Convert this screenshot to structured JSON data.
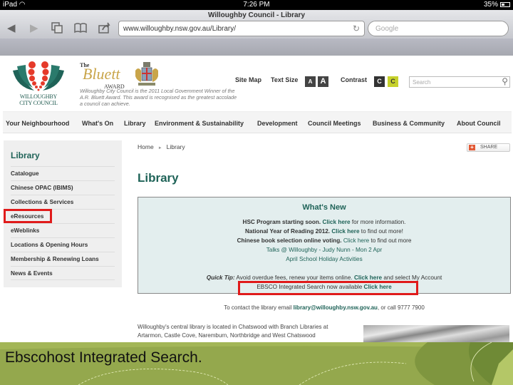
{
  "status_bar": {
    "device": "iPad",
    "time": "7:26 PM",
    "battery": "35%"
  },
  "browser": {
    "page_title": "Willoughby Council - Library",
    "url": "www.willoughby.nsw.gov.au/Library/",
    "search_placeholder": "Google"
  },
  "header": {
    "logo_line1": "WILLOUGHBY",
    "logo_line2": "CITY COUNCIL",
    "award_the": "The",
    "award_name": "Bluett",
    "award_word": "AWARD",
    "award_text": "Willoughby City Council is the 2011 Local Government Winner of the A.R. Bluett Award. This award is recognised as the greatest accolade a council can achieve.",
    "site_map": "Site Map",
    "text_size_label": "Text Size",
    "text_size_small": "A",
    "text_size_large": "A",
    "contrast_label": "Contrast",
    "contrast_dark": "C",
    "contrast_light": "C",
    "search_placeholder": "Search"
  },
  "nav": {
    "items": [
      "Your Neighbourhood",
      "What's On",
      "Library",
      "Environment & Sustainability",
      "Development",
      "Council Meetings",
      "Business & Community",
      "About Council"
    ]
  },
  "sidebar": {
    "title": "Library",
    "items": [
      "Catalogue",
      "Chinese OPAC (IBIMS)",
      "Collections & Services",
      "eResources",
      "eWeblinks",
      "Locations & Opening Hours",
      "Membership & Renewing Loans",
      "News & Events"
    ],
    "highlighted_item": "eResources"
  },
  "main": {
    "breadcrumb": [
      "Home",
      "Library"
    ],
    "share_label": "SHARE",
    "title": "Library",
    "whats_new": {
      "heading": "What's New",
      "lines": [
        {
          "bold": "HSC Program starting soon.",
          "link": "Click here",
          "rest": "for more information."
        },
        {
          "bold": "National Year of Reading 2012.",
          "link": "Click here",
          "rest": "to find out more!"
        },
        {
          "bold": "Chinese book selection online voting.",
          "link": "Click here",
          "rest": "to find out more"
        }
      ],
      "link_lines": [
        "Talks @ Willoughby - Judy Nunn - Mon 2 Apr",
        "April School Holiday Activities"
      ],
      "quick_tip": {
        "label": "Quick Tip:",
        "text": "Avoid overdue fees, renew your items online.",
        "link": "Click here",
        "rest": "and select My Account"
      },
      "ebsco": {
        "text": "EBSCO Integrated Search now available",
        "link": "Click here"
      }
    },
    "contact": {
      "prefix": "To contact the library email",
      "email": "library@willoughby.nsw.gov.au",
      "suffix": ", or call 9777 7900"
    },
    "about": "Willoughby's central library is located in Chatswood with Branch Libraries at Artarmon, Castle Cove, Naremburn, Northbridge and West Chatswood"
  },
  "caption": "Ebscohost Integrated Search.",
  "colors": {
    "accent_teal": "#1f6358",
    "highlight_red": "#e01b1b",
    "contrast_yellow": "#c6d12b",
    "caption_green": "#94a84d"
  }
}
